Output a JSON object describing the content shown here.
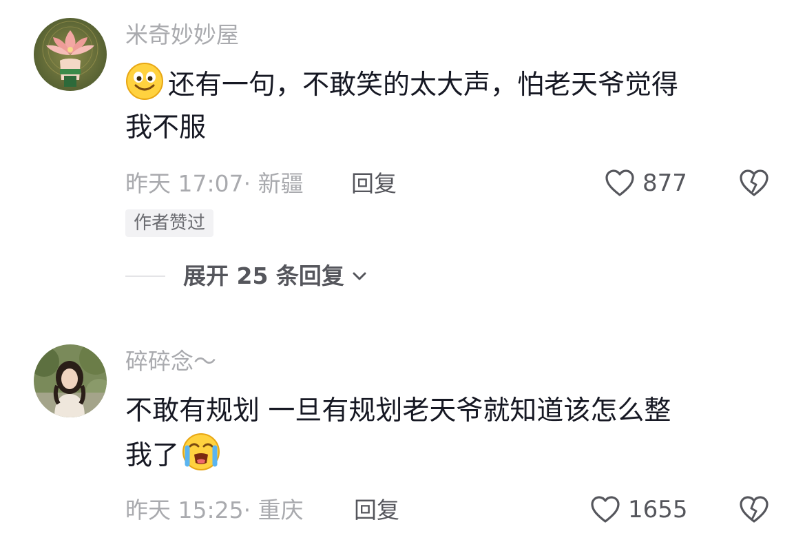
{
  "comments": [
    {
      "username": "米奇妙妙屋",
      "avatar_icon": "lotus-hand-avatar",
      "lines": [
        "还有一句，不敢笑的太大声，怕老天爷觉得",
        "我不服"
      ],
      "emoji_icon": "smiling-face-emoji",
      "time": "昨天 17:07",
      "location": "新疆",
      "meta": "昨天 17:07· 新疆",
      "reply_label": "回复",
      "like_count": "877",
      "author_badge": "作者赞过",
      "expand_label": "展开 25 条回复"
    },
    {
      "username": "碎碎念～",
      "avatar_icon": "girl-photo-avatar",
      "lines": [
        "不敢有规划  一旦有规划老天爷就知道该怎么整",
        "我了"
      ],
      "emoji_icon": "crying-face-emoji",
      "time": "昨天 15:25",
      "location": "重庆",
      "meta": "昨天 15:25· 重庆",
      "reply_label": "回复",
      "like_count": "1655"
    }
  ],
  "icons": {
    "like": "heart-outline-icon",
    "dislike": "broken-heart-icon",
    "expand": "chevron-down-icon"
  },
  "colors": {
    "text_primary": "#161823",
    "text_secondary": "#a9aaae",
    "text_action": "#55565c",
    "badge_bg": "#f2f2f4"
  }
}
